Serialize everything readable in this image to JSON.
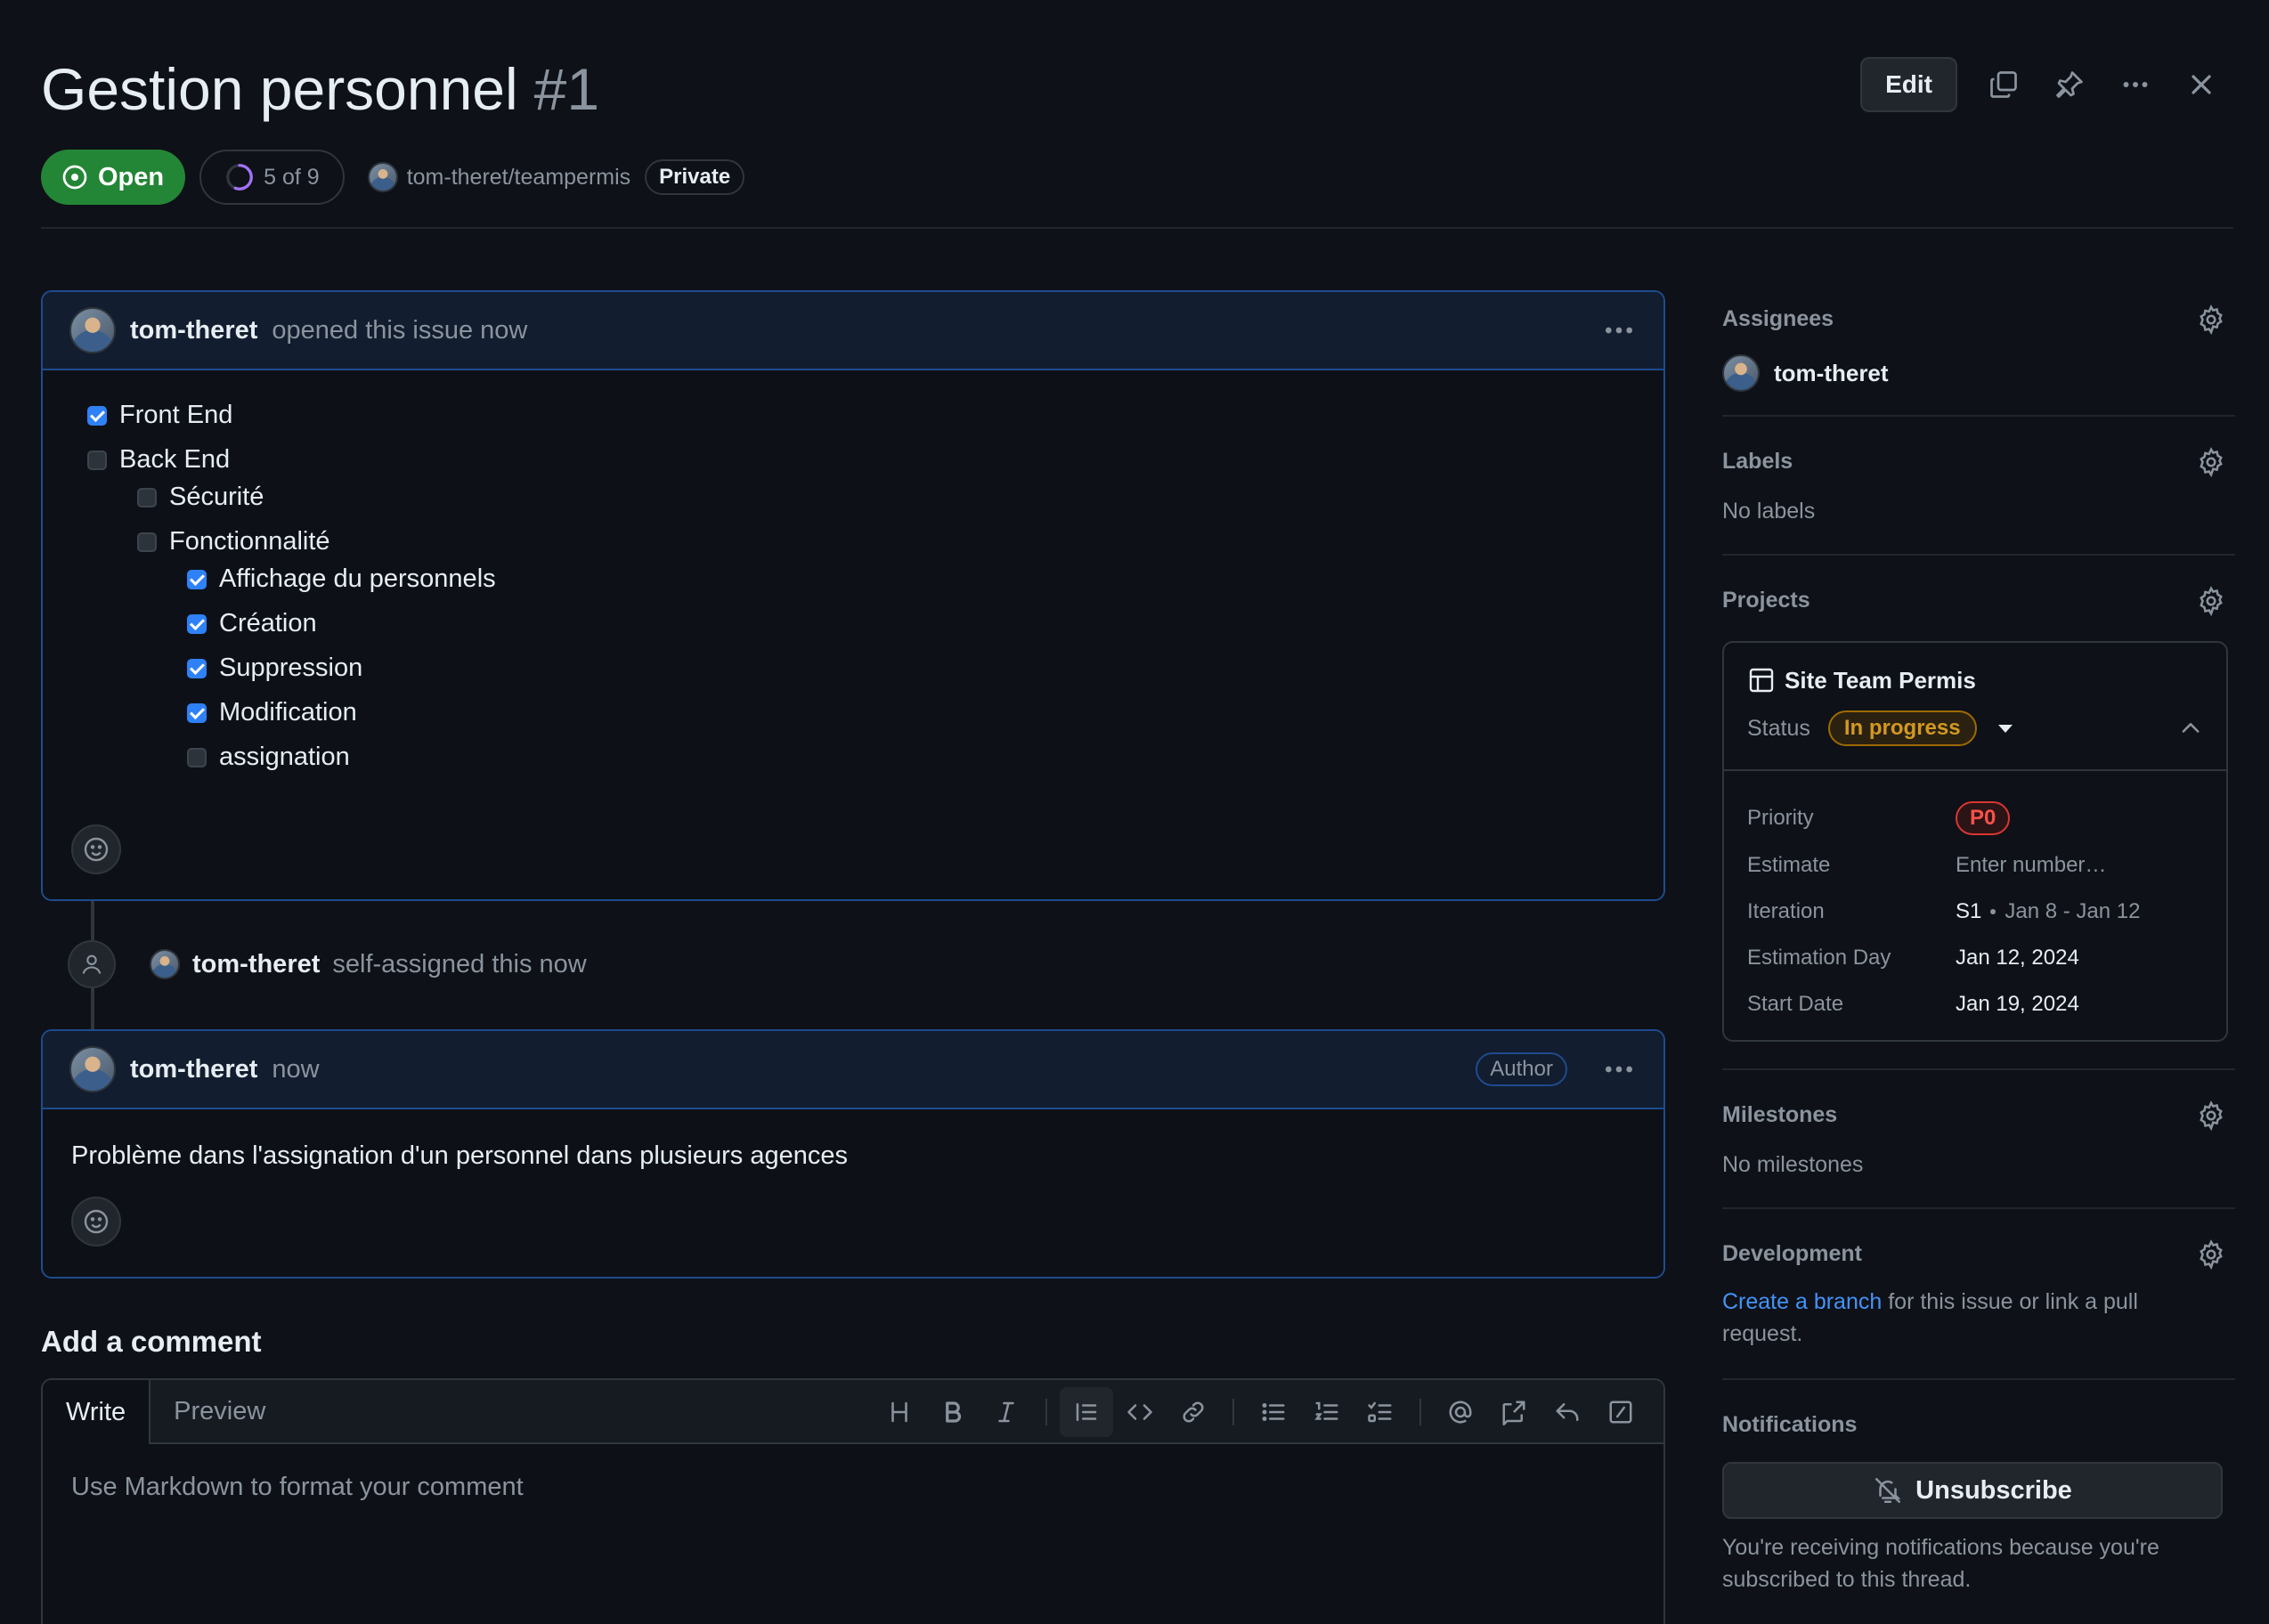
{
  "issue": {
    "title": "Gestion personnel",
    "number": "#1",
    "state": "Open",
    "progress_text": "5 of 9",
    "progress_fraction": 0.5556,
    "repo": "tom-theret/teampermis",
    "visibility": "Private"
  },
  "header_actions": {
    "edit_label": "Edit",
    "icons": [
      "copy-icon",
      "pin-icon",
      "kebab-icon",
      "close-icon"
    ]
  },
  "first_comment": {
    "author": "tom-theret",
    "action": "opened this issue now",
    "tasks": [
      {
        "label": "Front End",
        "checked": true,
        "level": 0
      },
      {
        "label": "Back End",
        "checked": false,
        "level": 0
      },
      {
        "label": "Sécurité",
        "checked": false,
        "level": 1
      },
      {
        "label": "Fonctionnalité",
        "checked": false,
        "level": 1
      },
      {
        "label": "Affichage du personnels",
        "checked": true,
        "level": 2
      },
      {
        "label": "Création",
        "checked": true,
        "level": 2
      },
      {
        "label": "Suppression",
        "checked": true,
        "level": 2
      },
      {
        "label": "Modification",
        "checked": true,
        "level": 2
      },
      {
        "label": "assignation",
        "checked": false,
        "level": 2
      }
    ]
  },
  "timeline_event": {
    "author": "tom-theret",
    "action": "self-assigned this now"
  },
  "second_comment": {
    "author": "tom-theret",
    "time": "now",
    "badge": "Author",
    "body": "Problème dans l'assignation d'un personnel dans plusieurs agences"
  },
  "composer": {
    "title": "Add a comment",
    "tabs": [
      "Write",
      "Preview"
    ],
    "placeholder": "Use Markdown to format your comment",
    "toolbar_icons": [
      "heading-icon",
      "bold-icon",
      "italic-icon",
      "quote-icon",
      "code-icon",
      "link-icon",
      "bullet-list-icon",
      "numbered-list-icon",
      "task-list-icon",
      "mention-icon",
      "cross-reference-icon",
      "reply-icon",
      "slash-command-icon"
    ]
  },
  "sidebar": {
    "assignees": {
      "title": "Assignees",
      "user": "tom-theret"
    },
    "labels": {
      "title": "Labels",
      "empty": "No labels"
    },
    "projects": {
      "title": "Projects",
      "name": "Site Team Permis",
      "status_label": "Status",
      "status_value": "In progress",
      "fields": {
        "priority_label": "Priority",
        "priority_value": "P0",
        "estimate_label": "Estimate",
        "estimate_placeholder": "Enter number…",
        "iteration_label": "Iteration",
        "iteration_name": "S1",
        "iteration_range": "Jan 8 - Jan 12",
        "estimation_day_label": "Estimation Day",
        "estimation_day_value": "Jan 12, 2024",
        "start_date_label": "Start Date",
        "start_date_value": "Jan 19, 2024"
      }
    },
    "milestones": {
      "title": "Milestones",
      "empty": "No milestones"
    },
    "development": {
      "title": "Development",
      "link": "Create a branch",
      "text": "for this issue or link a pull request."
    },
    "notifications": {
      "title": "Notifications",
      "button": "Unsubscribe",
      "reason": "You're receiving notifications because you're subscribed to this thread."
    }
  },
  "colors": {
    "background": "#0e1117",
    "open_green": "#238636",
    "accent_blue": "#2f81f7",
    "comment_border": "#1f4b8e",
    "status_yellow": "#d29922",
    "priority_red": "#f85149",
    "progress_purple": "#a371f7"
  }
}
